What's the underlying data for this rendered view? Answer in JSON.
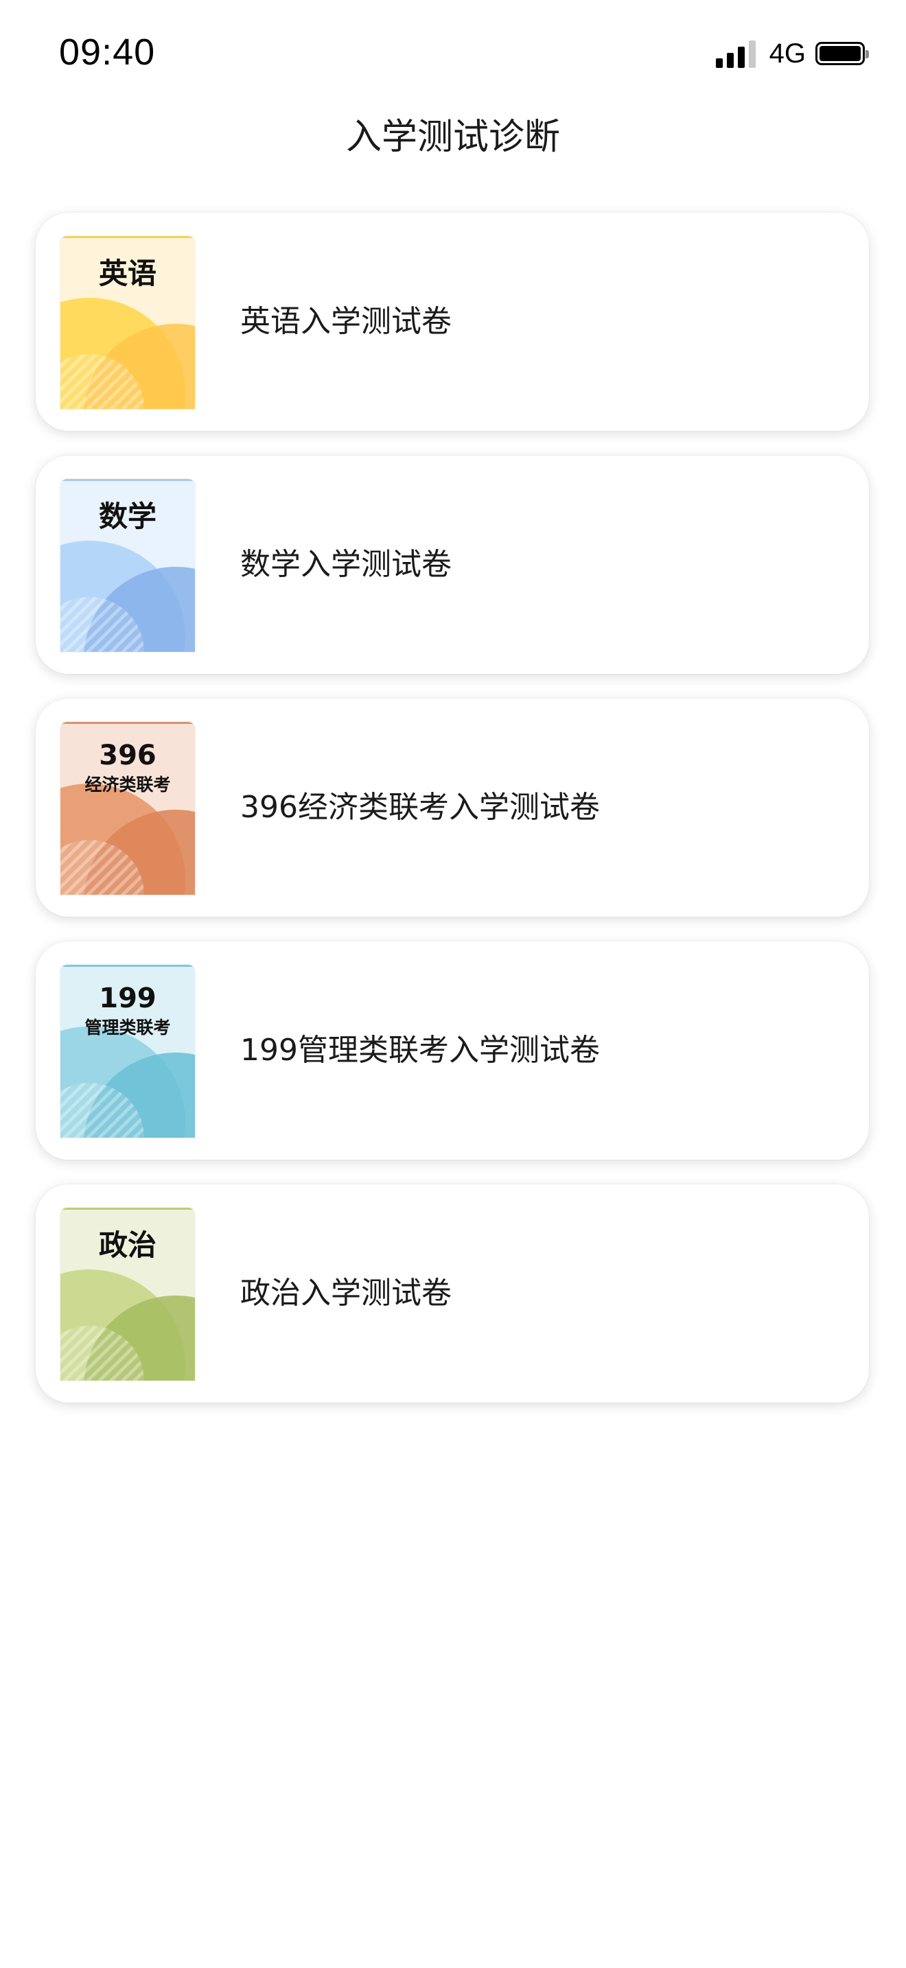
{
  "status_bar": {
    "time": "09:40",
    "network": "4G",
    "icons": [
      "signal-bars-icon",
      "battery-icon"
    ]
  },
  "page": {
    "title": "入学测试诊断"
  },
  "courses": [
    {
      "cover_label": "英语",
      "cover_sublabel": "",
      "title": "英语入学测试卷",
      "colors": {
        "bg": "#FFF4DA",
        "accent1": "#FFD74E",
        "accent2": "#FFC54B",
        "border": "#F4D15A"
      }
    },
    {
      "cover_label": "数学",
      "cover_sublabel": "",
      "title": "数学入学测试卷",
      "colors": {
        "bg": "#E8F3FD",
        "accent1": "#AED4F8",
        "accent2": "#86B1EA",
        "border": "#A8CBEE"
      }
    },
    {
      "cover_label": "396",
      "cover_sublabel": "经济类联考",
      "title": "396经济类联考入学测试卷",
      "colors": {
        "bg": "#F8E3D8",
        "accent1": "#E7986C",
        "accent2": "#DC8458",
        "border": "#D9946E"
      }
    },
    {
      "cover_label": "199",
      "cover_sublabel": "管理类联考",
      "title": "199管理类联考入学测试卷",
      "colors": {
        "bg": "#DDF1F6",
        "accent1": "#92D3E3",
        "accent2": "#6ABFD6",
        "border": "#7EC8DC"
      }
    },
    {
      "cover_label": "政治",
      "cover_sublabel": "",
      "title": "政治入学测试卷",
      "colors": {
        "bg": "#EEF2DC",
        "accent1": "#C6D787",
        "accent2": "#A6BC5E",
        "border": "#BCCD7A"
      }
    }
  ]
}
